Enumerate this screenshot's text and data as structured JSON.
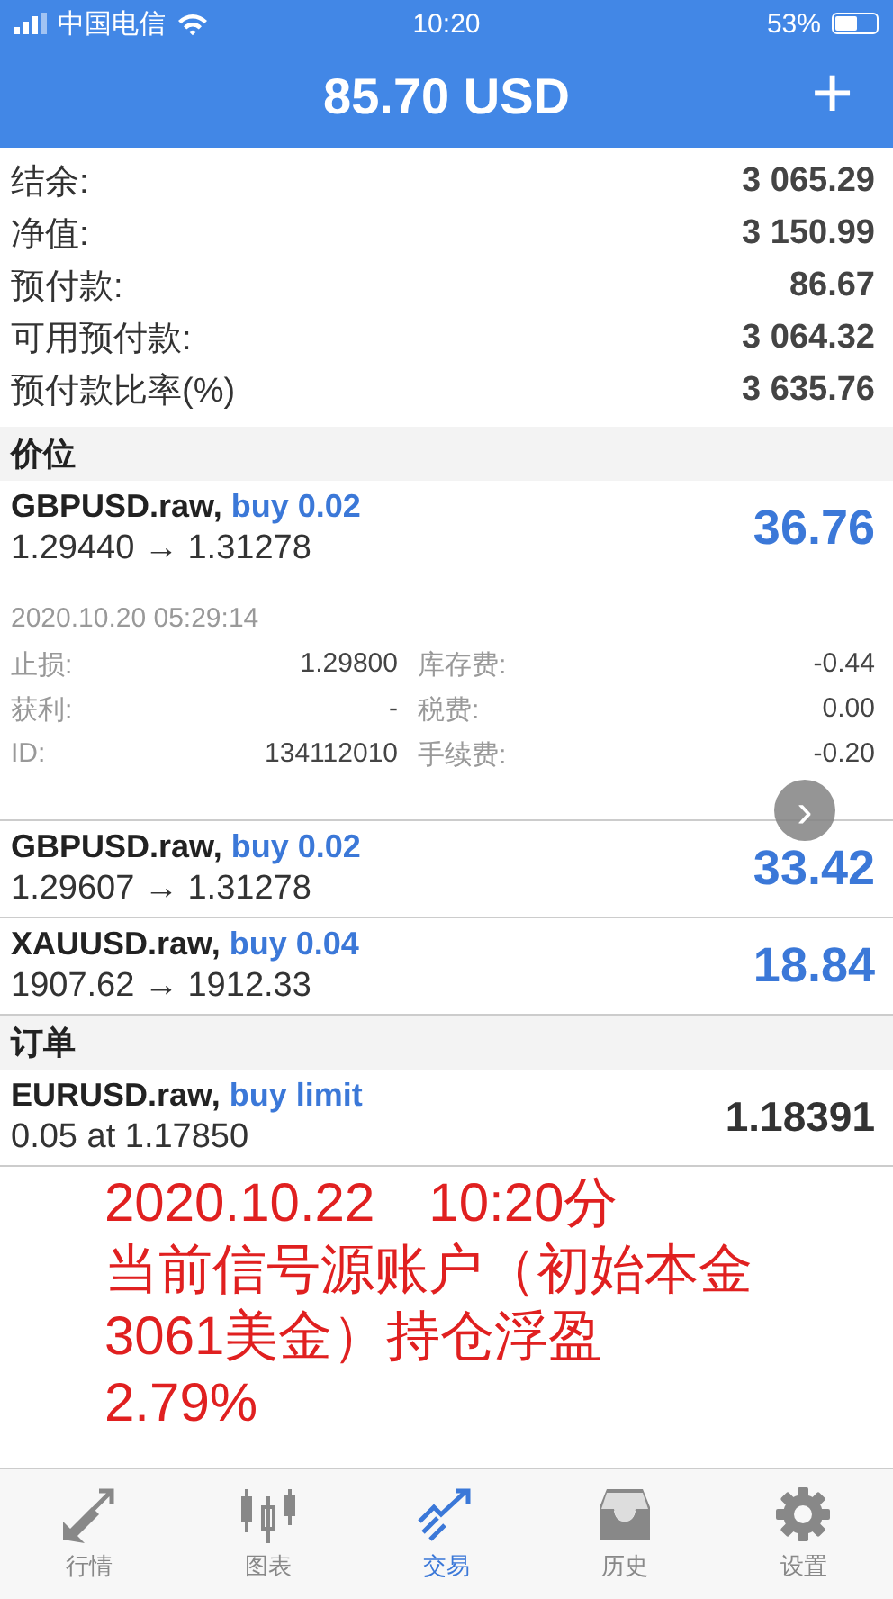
{
  "status_bar": {
    "carrier": "中国电信",
    "time": "10:20",
    "battery": "53%"
  },
  "header": {
    "title": "85.70 USD",
    "add_button": "+"
  },
  "summary": [
    {
      "label": "结余:",
      "value": "3 065.29"
    },
    {
      "label": "净值:",
      "value": "3 150.99"
    },
    {
      "label": "预付款:",
      "value": "86.67"
    },
    {
      "label": "可用预付款:",
      "value": "3 064.32"
    },
    {
      "label": "预付款比率(%)",
      "value": "3 635.76"
    }
  ],
  "positions_section": {
    "title": "价位"
  },
  "positions": [
    {
      "symbol": "GBPUSD.raw,",
      "side": "buy 0.02",
      "prices": "1.29440 → 1.31278",
      "profit": "36.76",
      "expanded": true,
      "time": "2020.10.20 05:29:14",
      "details": [
        [
          "止损:",
          "1.29800",
          "库存费:",
          "-0.44"
        ],
        [
          "获利:",
          "-",
          "税费:",
          "0.00"
        ],
        [
          "ID:",
          "134112010",
          "手续费:",
          "-0.20"
        ]
      ]
    },
    {
      "symbol": "GBPUSD.raw,",
      "side": "buy 0.02",
      "prices": "1.29607 → 1.31278",
      "profit": "33.42",
      "expanded": false
    },
    {
      "symbol": "XAUUSD.raw,",
      "side": "buy 0.04",
      "prices": "1907.62 → 1912.33",
      "profit": "18.84",
      "expanded": false
    }
  ],
  "orders_section": {
    "title": "订单"
  },
  "orders": [
    {
      "symbol": "EURUSD.raw,",
      "side": "buy limit",
      "prices": "0.05 at 1.17850",
      "price": "1.18391"
    }
  ],
  "annotation": [
    "2020.10.22　10:20分",
    "当前信号源账户（初始本金",
    "3061美金）持仓浮盈",
    "2.79%"
  ],
  "floating_button": {
    "label": "›"
  },
  "tabs": [
    {
      "label": "行情",
      "kind": "quotes",
      "selected": false
    },
    {
      "label": "图表",
      "kind": "chart",
      "selected": false
    },
    {
      "label": "交易",
      "kind": "trade",
      "selected": true
    },
    {
      "label": "历史",
      "kind": "history",
      "selected": false
    },
    {
      "label": "设置",
      "kind": "settings",
      "selected": false
    }
  ]
}
